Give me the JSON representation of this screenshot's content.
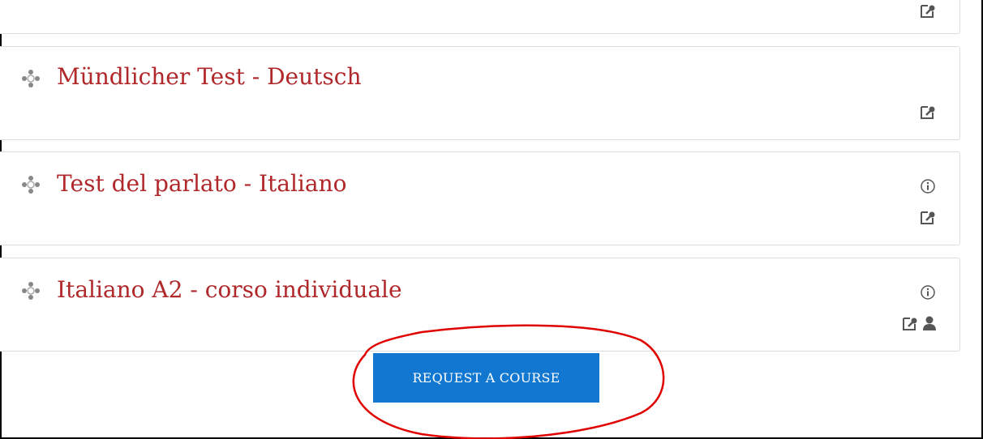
{
  "courses": [
    {
      "title": "Mündlicher Test - Deutsch",
      "icons": [
        "enrol-key-icon"
      ]
    },
    {
      "title": "Test del parlato - Italiano",
      "icons": [
        "info-icon",
        "enrol-key-icon"
      ]
    },
    {
      "title": "Italiano A2 - corso individuale",
      "icons": [
        "info-icon",
        "enrol-key-icon",
        "user-icon"
      ]
    }
  ],
  "request_button": {
    "label": "REQUEST A COURSE"
  },
  "colors": {
    "link": "#b0282a",
    "button": "#1177d1",
    "annotation_circle": "#e00000",
    "icon": "#555555"
  }
}
